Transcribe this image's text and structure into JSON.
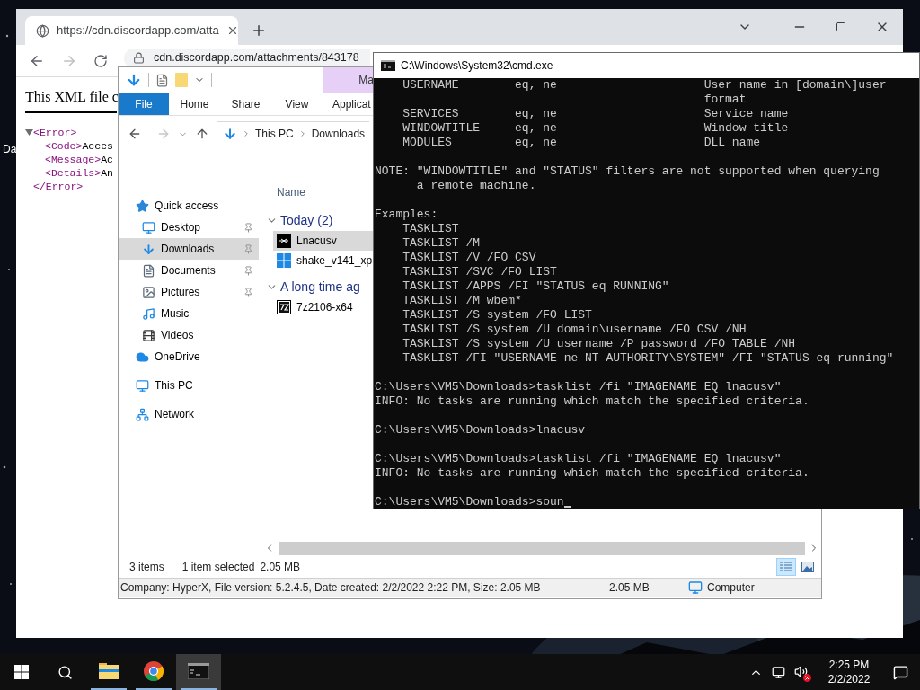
{
  "desktop": {
    "icon_label": "Da"
  },
  "browser": {
    "tab": {
      "title": "https://cdn.discordapp.com/atta",
      "selected": true
    },
    "address": "cdn.discordapp.com/attachments/843178",
    "heading": "This XML file c",
    "xml": {
      "expanded": true,
      "open_tag": "<Error>",
      "close_tag": "</Error>",
      "children": [
        {
          "tag": "<Code>",
          "value": "Acces"
        },
        {
          "tag": "<Message>",
          "value": "Ac"
        },
        {
          "tag": "<Details>",
          "value": "An"
        }
      ]
    }
  },
  "explorer": {
    "context_tab": "Ma",
    "ribbon_tabs": [
      {
        "label": "File",
        "selected": true
      },
      {
        "label": "Home",
        "selected": false
      },
      {
        "label": "Share",
        "selected": false
      },
      {
        "label": "View",
        "selected": false
      },
      {
        "label": "Applicat",
        "selected": false
      }
    ],
    "breadcrumb": [
      "This PC",
      "Downloads"
    ],
    "navigation": [
      {
        "label": "Quick access",
        "kind": "quick-access",
        "selected": false,
        "children": [
          {
            "label": "Desktop",
            "kind": "desktop",
            "pinned": true,
            "selected": false
          },
          {
            "label": "Downloads",
            "kind": "downloads",
            "pinned": true,
            "selected": true
          },
          {
            "label": "Documents",
            "kind": "documents",
            "pinned": true,
            "selected": false
          },
          {
            "label": "Pictures",
            "kind": "pictures",
            "pinned": true,
            "selected": false
          },
          {
            "label": "Music",
            "kind": "music",
            "pinned": false,
            "selected": false
          },
          {
            "label": "Videos",
            "kind": "videos",
            "pinned": false,
            "selected": false
          }
        ]
      },
      {
        "label": "OneDrive",
        "kind": "cloud",
        "selected": false
      },
      {
        "label": "This PC",
        "kind": "computer",
        "selected": false
      },
      {
        "label": "Network",
        "kind": "network",
        "selected": false
      }
    ],
    "column": "Name",
    "groups": [
      {
        "title": "Today (2)",
        "expanded": true,
        "files": [
          {
            "name": "Lnacusv",
            "kind": "app",
            "selected": true
          },
          {
            "name": "shake_v141_xp",
            "kind": "windows",
            "selected": false
          }
        ]
      },
      {
        "title": "A long time ag",
        "expanded": true,
        "files": [
          {
            "name": "7z2106-x64",
            "kind": "archive",
            "selected": false
          }
        ]
      }
    ],
    "status": {
      "items": "3 items",
      "selection": "1 item selected",
      "selection_size": "2.05 MB"
    },
    "views": [
      {
        "kind": "details",
        "selected": true
      },
      {
        "kind": "large-icons",
        "selected": false
      }
    ],
    "details_bar": {
      "info": "Company: HyperX, File version: 5.2.4.5, Date created: 2/2/2022 2:22 PM, Size: 2.05 MB",
      "size": "2.05 MB",
      "zone": "Computer"
    }
  },
  "console": {
    "title": "C:\\Windows\\System32\\cmd.exe",
    "cursor": true,
    "blocks": [
      [
        "    USERNAME        eq, ne                     User name in [domain\\]user",
        "                                               format",
        "    SERVICES        eq, ne                     Service name",
        "    WINDOWTITLE     eq, ne                     Window title",
        "    MODULES         eq, ne                     DLL name"
      ],
      [
        "NOTE: \"WINDOWTITLE\" and \"STATUS\" filters are not supported when querying",
        "      a remote machine."
      ],
      [
        "Examples:",
        "    TASKLIST",
        "    TASKLIST /M",
        "    TASKLIST /V /FO CSV",
        "    TASKLIST /SVC /FO LIST",
        "    TASKLIST /APPS /FI \"STATUS eq RUNNING\"",
        "    TASKLIST /M wbem*",
        "    TASKLIST /S system /FO LIST",
        "    TASKLIST /S system /U domain\\username /FO CSV /NH",
        "    TASKLIST /S system /U username /P password /FO TABLE /NH",
        "    TASKLIST /FI \"USERNAME ne NT AUTHORITY\\SYSTEM\" /FI \"STATUS eq running\""
      ],
      [
        "C:\\Users\\VM5\\Downloads>tasklist /fi \"IMAGENAME EQ lnacusv\"",
        "INFO: No tasks are running which match the specified criteria."
      ],
      [
        "C:\\Users\\VM5\\Downloads>lnacusv"
      ],
      [
        "C:\\Users\\VM5\\Downloads>tasklist /fi \"IMAGENAME EQ lnacusv\"",
        "INFO: No tasks are running which match the specified criteria."
      ],
      [
        "C:\\Users\\VM5\\Downloads>soun"
      ]
    ]
  },
  "taskbar": {
    "apps": [
      {
        "kind": "explorer",
        "running": true,
        "active": false
      },
      {
        "kind": "browser",
        "running": true,
        "active": false
      },
      {
        "kind": "console",
        "running": true,
        "active": true
      }
    ],
    "volume_muted": true,
    "time": "2:25 PM",
    "date": "2/2/2022"
  }
}
